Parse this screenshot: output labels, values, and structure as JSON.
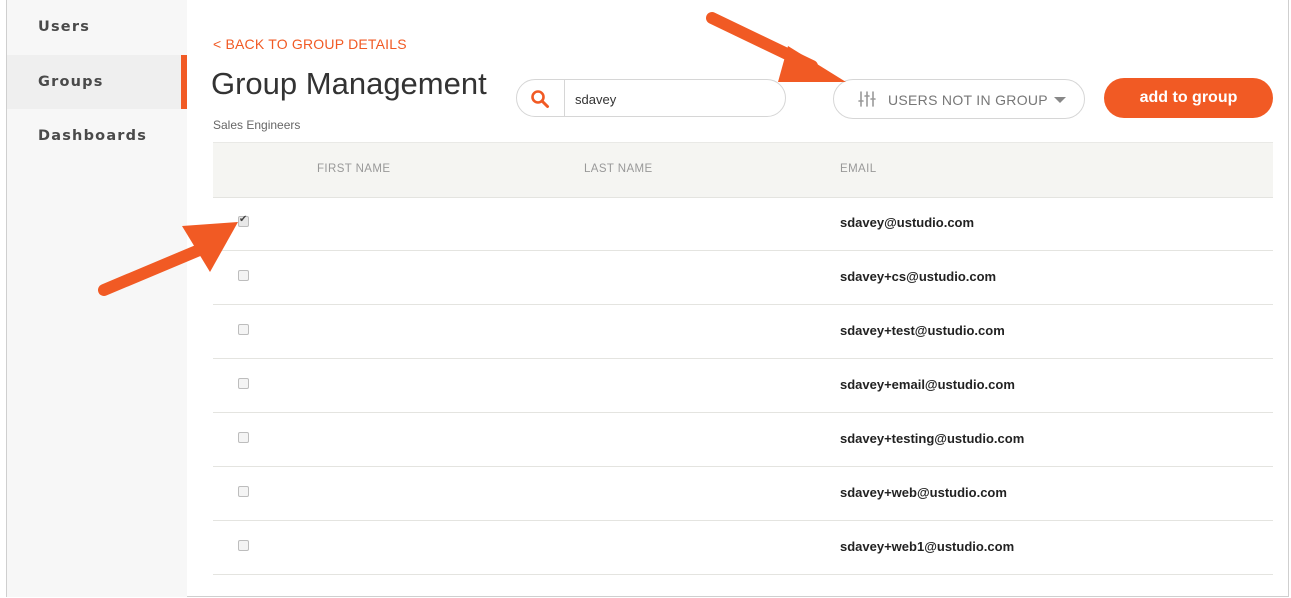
{
  "sidebar": {
    "items": [
      {
        "label": "Users",
        "active": false
      },
      {
        "label": "Groups",
        "active": true
      },
      {
        "label": "Dashboards",
        "active": false
      }
    ]
  },
  "header": {
    "back_link": "< BACK TO GROUP DETAILS",
    "title": "Group Management",
    "subtitle": "Sales Engineers"
  },
  "search": {
    "value": "sdavey",
    "icon": "search-icon"
  },
  "filter": {
    "selected": "USERS NOT IN GROUP",
    "icon": "sliders-icon"
  },
  "actions": {
    "add_label": "add to group"
  },
  "table": {
    "columns": [
      "FIRST NAME",
      "LAST NAME",
      "EMAIL"
    ],
    "rows": [
      {
        "checked": true,
        "first": "",
        "last": "",
        "email": "sdavey@ustudio.com"
      },
      {
        "checked": false,
        "first": "",
        "last": "",
        "email": "sdavey+cs@ustudio.com"
      },
      {
        "checked": false,
        "first": "",
        "last": "",
        "email": "sdavey+test@ustudio.com"
      },
      {
        "checked": false,
        "first": "",
        "last": "",
        "email": "sdavey+email@ustudio.com"
      },
      {
        "checked": false,
        "first": "",
        "last": "",
        "email": "sdavey+testing@ustudio.com"
      },
      {
        "checked": false,
        "first": "",
        "last": "",
        "email": "sdavey+web@ustudio.com"
      },
      {
        "checked": false,
        "first": "",
        "last": "",
        "email": "sdavey+web1@ustudio.com"
      }
    ]
  },
  "colors": {
    "accent": "#f15a24",
    "annotation_arrow": "#f15a24"
  }
}
